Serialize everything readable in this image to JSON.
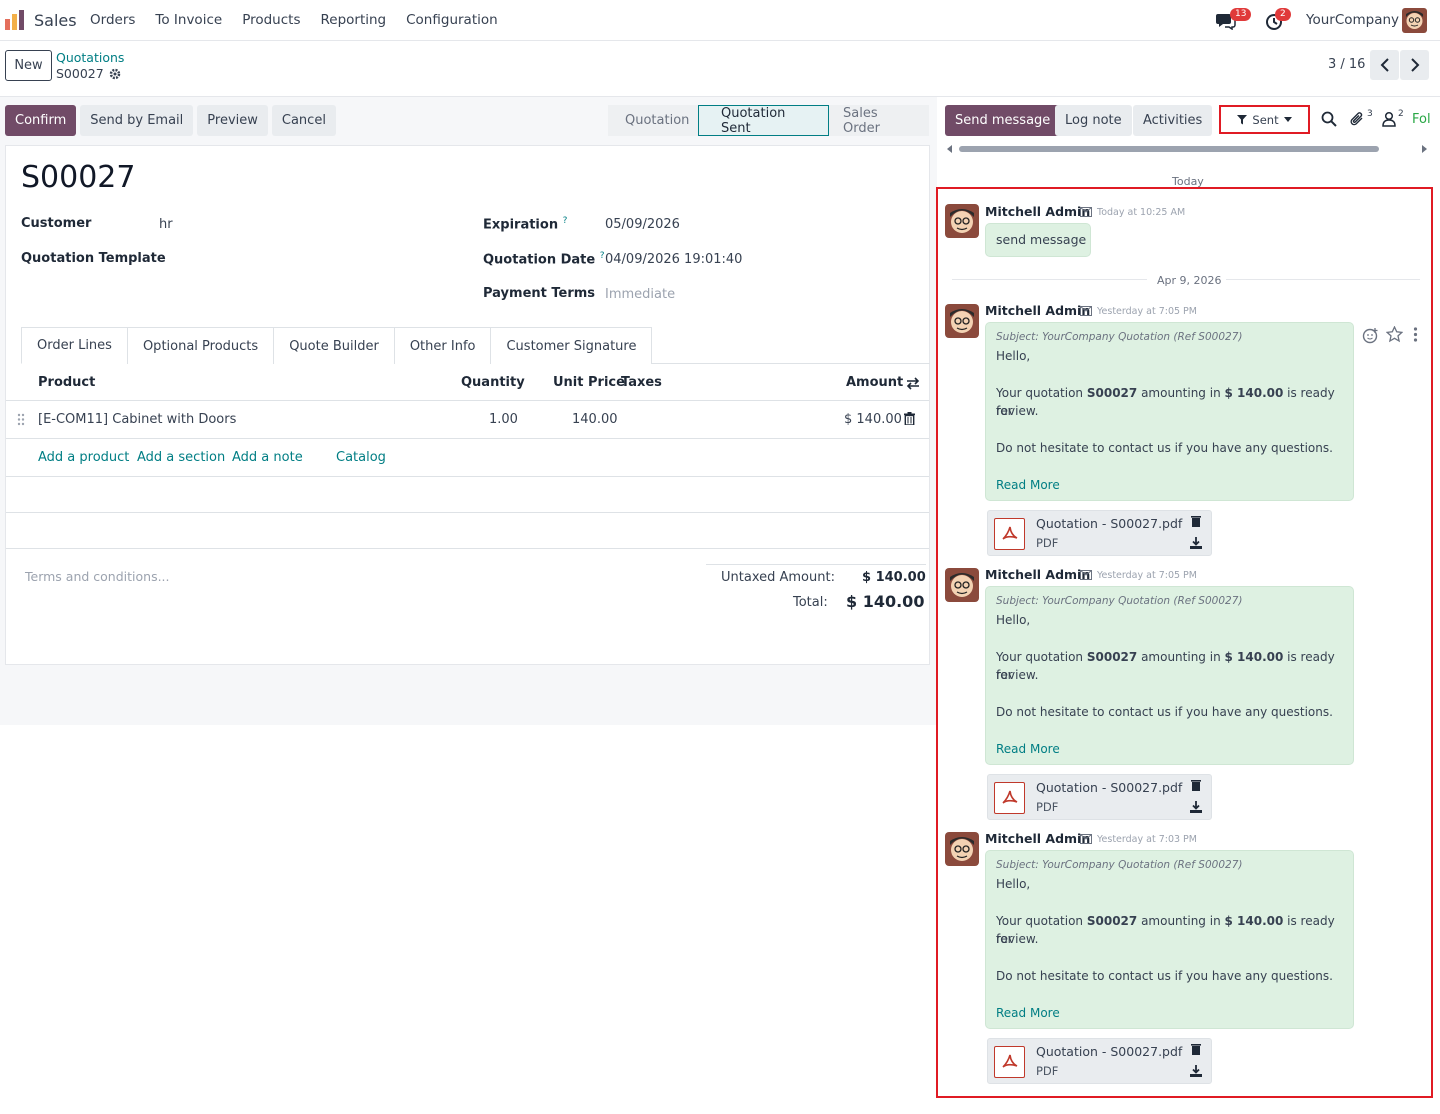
{
  "navbar": {
    "app_name": "Sales",
    "menu": [
      "Orders",
      "To Invoice",
      "Products",
      "Reporting",
      "Configuration"
    ],
    "messages_badge": "13",
    "activities_badge": "2",
    "company": "YourCompany"
  },
  "control_panel": {
    "new_label": "New",
    "breadcrumb_parent": "Quotations",
    "breadcrumb_current": "S00027",
    "pager": "3 / 16"
  },
  "statusbar": {
    "buttons": [
      "Confirm",
      "Send by Email",
      "Preview",
      "Cancel"
    ],
    "stages": [
      "Quotation",
      "Quotation Sent",
      "Sales Order"
    ],
    "active_stage": "Quotation Sent"
  },
  "form": {
    "title": "S00027",
    "customer_label": "Customer",
    "customer_value": "hr",
    "template_label": "Quotation Template",
    "expiration_label": "Expiration",
    "expiration_value": "05/09/2026",
    "qdate_label": "Quotation Date",
    "qdate_value": "04/09/2026 19:01:40",
    "payment_label": "Payment Terms",
    "payment_value": "Immediate",
    "help_mark": "?",
    "tabs": [
      "Order Lines",
      "Optional Products",
      "Quote Builder",
      "Other Info",
      "Customer Signature"
    ],
    "columns": {
      "product": "Product",
      "quantity": "Quantity",
      "unit_price": "Unit Price",
      "taxes": "Taxes",
      "amount": "Amount"
    },
    "line": {
      "product": "[E-COM11] Cabinet with Doors",
      "quantity": "1.00",
      "unit_price": "140.00",
      "amount": "$ 140.00"
    },
    "add_links": [
      "Add a product",
      "Add a section",
      "Add a note",
      "Catalog"
    ],
    "terms_placeholder": "Terms and conditions...",
    "untaxed_label": "Untaxed Amount:",
    "untaxed_value": "$ 140.00",
    "total_label": "Total:",
    "total_value": "$ 140.00"
  },
  "chatter": {
    "send_message": "Send message",
    "log_note": "Log note",
    "activities": "Activities",
    "filter_label": "Sent",
    "attachments_count": "3",
    "followers_count": "2",
    "follow_label": "Fol",
    "date_today": "Today",
    "date_apr": "Apr 9, 2026",
    "messages": [
      {
        "author": "Mitchell Admin",
        "date": "Today at 10:25 AM",
        "body": "send message"
      },
      {
        "author": "Mitchell Admin",
        "date": "Yesterday at 7:05 PM",
        "subject": "Subject: YourCompany Quotation (Ref S00027)",
        "hello": "Hello,",
        "line1_pre": "Your quotation ",
        "ref": "S00027",
        "line1_mid": " amounting in ",
        "amount": "$ 140.00",
        "line1_post": " is ready for",
        "line2": "review.",
        "line3": "Do not hesitate to contact us if you have any questions.",
        "read_more": "Read More",
        "attachment": "Quotation - S00027.pdf",
        "attachment_type": "PDF"
      },
      {
        "author": "Mitchell Admin",
        "date": "Yesterday at 7:05 PM",
        "subject": "Subject: YourCompany Quotation (Ref S00027)",
        "hello": "Hello,",
        "line1_pre": "Your quotation ",
        "ref": "S00027",
        "line1_mid": " amounting in ",
        "amount": "$ 140.00",
        "line1_post": " is ready for",
        "line2": "review.",
        "line3": "Do not hesitate to contact us if you have any questions.",
        "read_more": "Read More",
        "attachment": "Quotation - S00027.pdf",
        "attachment_type": "PDF"
      },
      {
        "author": "Mitchell Admin",
        "date": "Yesterday at 7:03 PM",
        "subject": "Subject: YourCompany Quotation (Ref S00027)",
        "hello": "Hello,",
        "line1_pre": "Your quotation ",
        "ref": "S00027",
        "line1_mid": " amounting in ",
        "amount": "$ 140.00",
        "line1_post": " is ready for",
        "line2": "review.",
        "line3": "Do not hesitate to contact us if you have any questions.",
        "read_more": "Read More",
        "attachment": "Quotation - S00027.pdf",
        "attachment_type": "PDF"
      }
    ]
  },
  "colors": {
    "brand": "#714b67",
    "link": "#017e84",
    "highlight": "#e01b24",
    "bubble": "#def1e2"
  }
}
